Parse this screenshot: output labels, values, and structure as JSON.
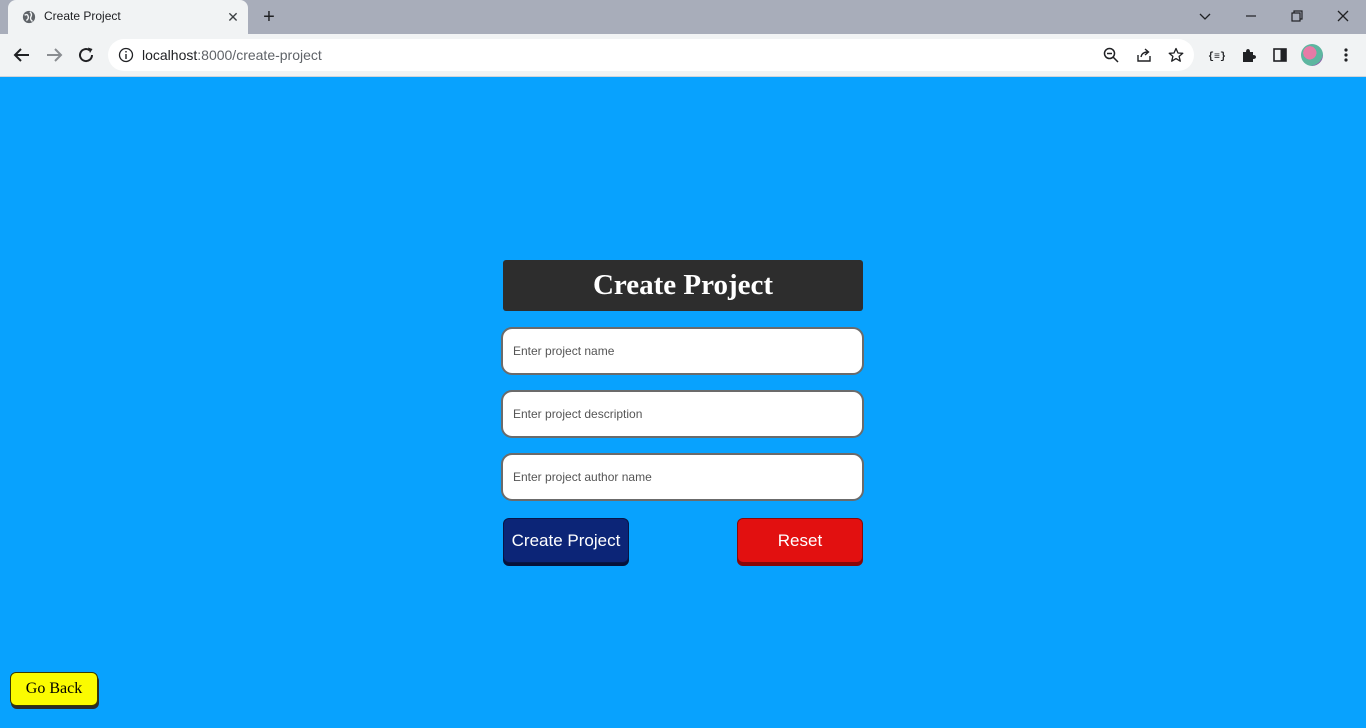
{
  "browser": {
    "tab_title": "Create Project",
    "tab_close": "✕",
    "new_tab": "+",
    "url_host": "localhost",
    "url_path": ":8000/create-project",
    "icons": [
      "globe-icon",
      "close-icon",
      "plus-icon",
      "chevron-down-icon",
      "minimize-icon",
      "restore-icon",
      "window-close-icon",
      "back-arrow-icon",
      "forward-arrow-icon",
      "reload-icon",
      "info-icon",
      "zoom-out-icon",
      "share-icon",
      "star-icon",
      "json-viewer-icon",
      "puzzle-icon",
      "side-panel-icon",
      "avatar",
      "kebab-menu-icon"
    ]
  },
  "page": {
    "heading": "Create Project",
    "fields": {
      "name_placeholder": "Enter project name",
      "description_placeholder": "Enter project description",
      "author_placeholder": "Enter project author name"
    },
    "buttons": {
      "create": "Create Project",
      "reset": "Reset",
      "back": "Go Back"
    }
  },
  "colors": {
    "background": "#08a2fe",
    "heading_bg": "#2d2d2d",
    "create_button": "#0c2577",
    "reset_button": "#e21010",
    "back_button": "#fbfb00"
  }
}
